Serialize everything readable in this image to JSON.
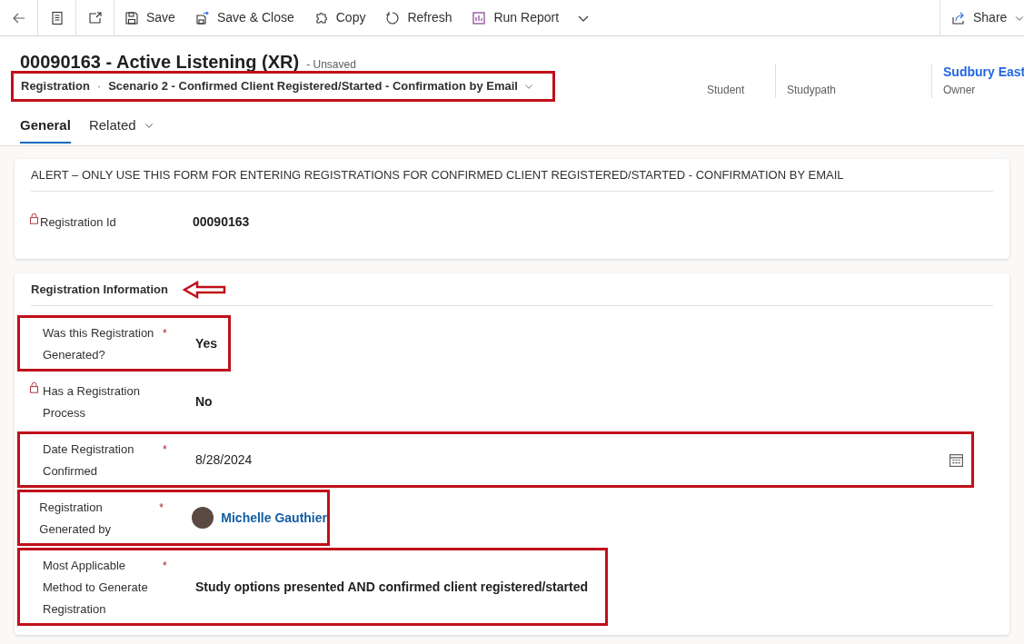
{
  "toolbar": {
    "commands": [
      {
        "kind": "back"
      },
      {
        "kind": "form"
      },
      {
        "kind": "popout"
      },
      {
        "kind": "save",
        "label": "Save"
      },
      {
        "kind": "saveclose",
        "label": "Save & Close"
      },
      {
        "kind": "copy",
        "label": "Copy"
      },
      {
        "kind": "refresh",
        "label": "Refresh"
      },
      {
        "kind": "report",
        "label": "Run Report"
      },
      {
        "kind": "more"
      }
    ],
    "share": "Share"
  },
  "header": {
    "title": "00090163 - Active Listening (XR)",
    "status": "- Unsaved",
    "entity": "Registration",
    "separator": "·",
    "form": "Scenario 2 - Confirmed Client Registered/Started - Confirmation by Email",
    "form_highlighted": true,
    "fields": [
      {
        "label": "Student",
        "kind": "plain"
      },
      {
        "label": "Studypath",
        "kind": "plain"
      },
      {
        "value": "Sudbury East",
        "label": "Owner",
        "kind": "link"
      }
    ]
  },
  "tabs": [
    {
      "label": "General",
      "selected": true,
      "has_menu": false
    },
    {
      "label": "Related",
      "selected": false,
      "has_menu": true
    }
  ],
  "alert": {
    "title": "ALERT – ONLY USE THIS FORM FOR ENTERING REGISTRATIONS FOR CONFIRMED CLIENT REGISTERED/STARTED - CONFIRMATION BY EMAIL",
    "fields": [
      {
        "label": "Registration Id",
        "value": "00090163",
        "kind": "text",
        "locked": true,
        "highlighted": false
      }
    ]
  },
  "section": {
    "title": "Registration Information",
    "pointer": true,
    "fields": [
      {
        "label": "Was this Registration Generated?",
        "required_mark": "*",
        "value": "Yes",
        "kind": "text",
        "locked": false,
        "highlighted": true
      },
      {
        "label": "Has a Registration Process",
        "value": "No",
        "kind": "text",
        "locked": true,
        "highlighted": false
      },
      {
        "label": "Date Registration Confirmed",
        "required_mark": "*",
        "value": "8/28/2024",
        "kind": "date",
        "locked": false,
        "highlighted": true
      },
      {
        "label": "Registration Generated by",
        "required_mark": "*",
        "value": "Michelle Gauthier",
        "kind": "lookup",
        "locked": false,
        "highlighted": true
      },
      {
        "label": "Most Applicable Method to Generate Registration",
        "required_mark": "*",
        "value": "Study options presented AND confirmed client registered/started",
        "kind": "text",
        "locked": false,
        "highlighted": true
      }
    ]
  }
}
